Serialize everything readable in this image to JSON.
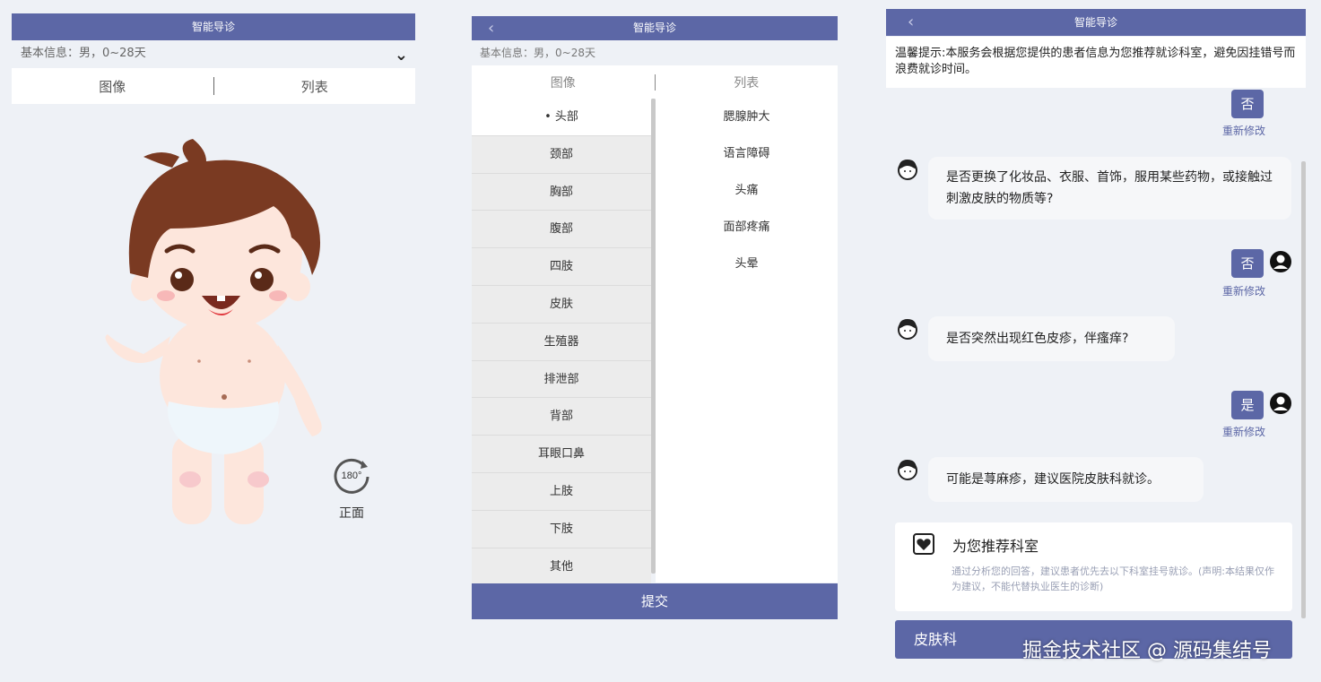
{
  "panel1": {
    "title": "智能导诊",
    "basic_info": "基本信息：男，0~28天",
    "tabs": [
      "图像",
      "列表"
    ],
    "rotate_label": "180°",
    "view_label": "正面"
  },
  "panel2": {
    "title": "智能导诊",
    "basic_info": "基本信息：男，0~28天",
    "tabs": [
      "图像",
      "列表"
    ],
    "categories": [
      "头部",
      "颈部",
      "胸部",
      "腹部",
      "四肢",
      "皮肤",
      "生殖器",
      "排泄部",
      "背部",
      "耳眼口鼻",
      "上肢",
      "下肢",
      "其他"
    ],
    "active_category_index": 0,
    "symptoms": [
      "腮腺肿大",
      "语言障碍",
      "头痛",
      "面部疼痛",
      "头晕"
    ],
    "submit": "提交"
  },
  "panel3": {
    "title": "智能导诊",
    "notice": "温馨提示:本服务会根据您提供的患者信息为您推荐就诊科室，避免因挂错号而浪费就诊时间。",
    "answers": [
      "否",
      "否",
      "是"
    ],
    "edit_label": "重新修改",
    "questions": [
      "是否更换了化妆品、衣服、首饰，服用某些药物，或接触过刺激皮肤的物质等?",
      "是否突然出现红色皮疹，伴瘙痒?",
      "可能是荨麻疹，建议医院皮肤科就诊。"
    ],
    "recommend_title": "为您推荐科室",
    "recommend_desc": "通过分析您的回答，建议患者优先去以下科室挂号就诊。(声明:本结果仅作为建议，不能代替执业医生的诊断)",
    "department": "皮肤科"
  },
  "watermark": "掘金技术社区 @ 源码集结号",
  "colors": {
    "primary": "#5c67a6",
    "background": "#eef1f6"
  }
}
